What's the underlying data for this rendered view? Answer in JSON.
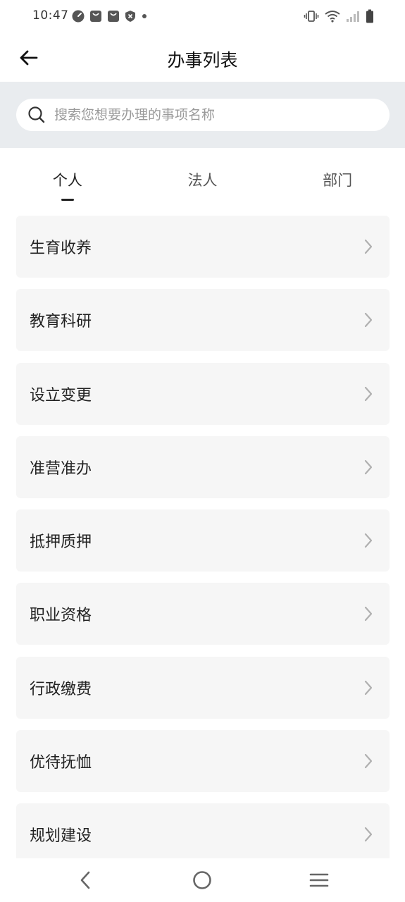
{
  "status_bar": {
    "time": "10:47"
  },
  "header": {
    "title": "办事列表"
  },
  "search": {
    "placeholder": "搜索您想要办理的事项名称"
  },
  "tabs": [
    {
      "label": "个人",
      "active": true
    },
    {
      "label": "法人",
      "active": false
    },
    {
      "label": "部门",
      "active": false
    }
  ],
  "items": [
    {
      "label": "生育收养"
    },
    {
      "label": "教育科研"
    },
    {
      "label": "设立变更"
    },
    {
      "label": "准营准办"
    },
    {
      "label": "抵押质押"
    },
    {
      "label": "职业资格"
    },
    {
      "label": "行政缴费"
    },
    {
      "label": "优待抚恤"
    },
    {
      "label": "规划建设"
    }
  ],
  "colors": {
    "search_strip_bg": "#e9ecef",
    "item_bg": "#f6f6f6",
    "chevron": "#b0b0b0",
    "tab_indicator": "#222222"
  }
}
